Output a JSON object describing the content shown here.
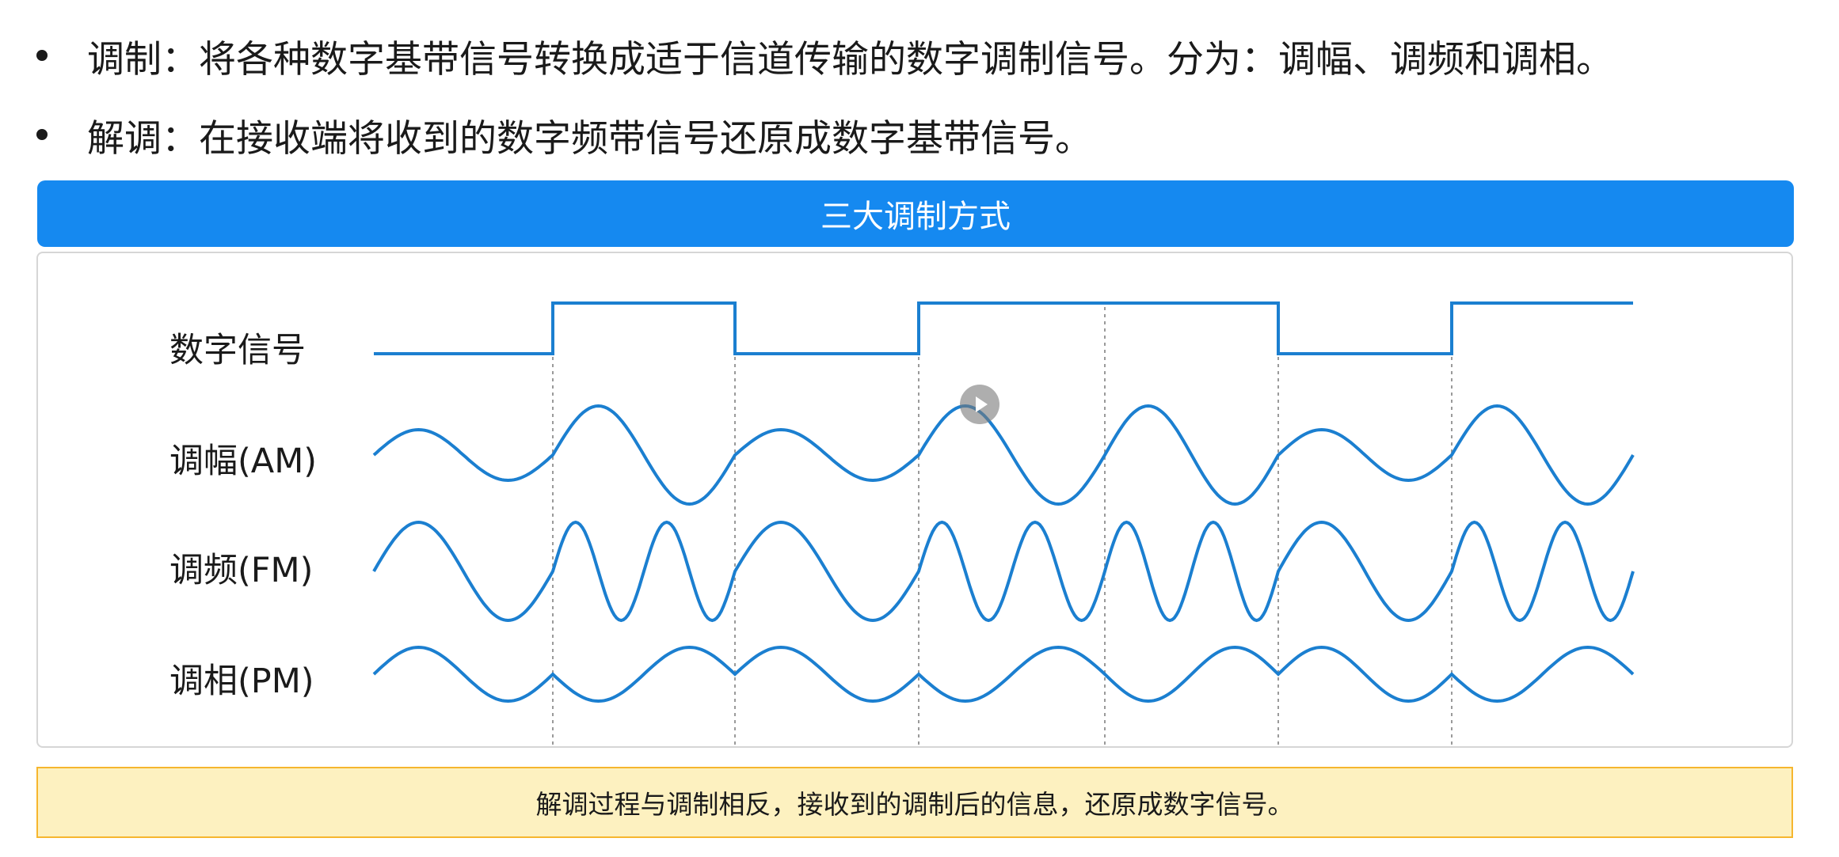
{
  "bullets": [
    "调制：将各种数字基带信号转换成适于信道传输的数字调制信号。分为：调幅、调频和调相。",
    "解调：在接收端将收到的数字频带信号还原成数字基带信号。"
  ],
  "diagram": {
    "title": "三大调制方式",
    "labels": {
      "digital": "数字信号",
      "am": "调幅(AM)",
      "fm": "调频(FM)",
      "pm": "调相(PM)"
    },
    "bits": [
      0,
      1,
      0,
      1,
      1,
      0,
      1
    ],
    "colors": {
      "wave": "#1b7fd0",
      "banner": "#1589f0",
      "grid": "#9a9a9a"
    }
  },
  "note": "解调过程与调制相反，接收到的调制后的信息，还原成数字信号。"
}
